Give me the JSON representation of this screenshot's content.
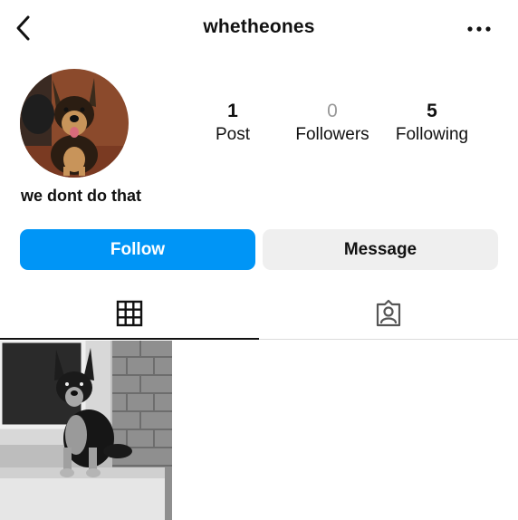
{
  "header": {
    "username": "whetheones",
    "back_icon": "chevron-left-icon",
    "more_icon": "more-horizontal-icon"
  },
  "profile": {
    "bio": "we dont do that",
    "stats": [
      {
        "value": "1",
        "label": "Post"
      },
      {
        "value": "0",
        "label": "Followers"
      },
      {
        "value": "5",
        "label": "Following"
      }
    ]
  },
  "actions": {
    "follow_label": "Follow",
    "message_label": "Message"
  },
  "tabs": [
    {
      "icon": "grid-icon",
      "active": true
    },
    {
      "icon": "tagged-icon",
      "active": false
    }
  ],
  "colors": {
    "accent": "#0095f6",
    "secondary_button": "#efefef",
    "muted": "#999999"
  }
}
